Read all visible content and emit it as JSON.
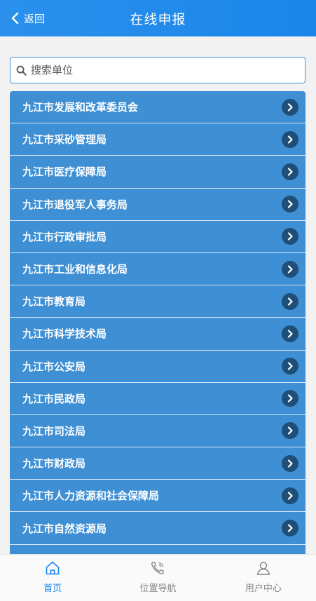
{
  "header": {
    "back_label": "返回",
    "title": "在线申报"
  },
  "search": {
    "placeholder": "搜索单位",
    "value": ""
  },
  "departments": [
    "九江市发展和改革委员会",
    "九江市采砂管理局",
    "九江市医疗保障局",
    "九江市退役军人事务局",
    "九江市行政审批局",
    "九江市工业和信息化局",
    "九江市教育局",
    "九江市科学技术局",
    "九江市公安局",
    "九江市民政局",
    "九江市司法局",
    "九江市财政局",
    "九江市人力资源和社会保障局",
    "九江市自然资源局"
  ],
  "tabbar": {
    "home_label": "首页",
    "nav_label": "位置导航",
    "user_label": "用户中心",
    "active": "home"
  },
  "colors": {
    "header": "#1a86ea",
    "row_bg": "#3e8fd3",
    "chevron_bg": "#1f4f78",
    "active_tab": "#1a86ea",
    "inactive_tab": "#888888"
  },
  "icons": {
    "back": "chevron-left-icon",
    "search": "search-icon",
    "row_arrow": "chevron-right-circle-icon",
    "home": "home-icon",
    "nav": "phone-icon",
    "user": "user-icon"
  }
}
